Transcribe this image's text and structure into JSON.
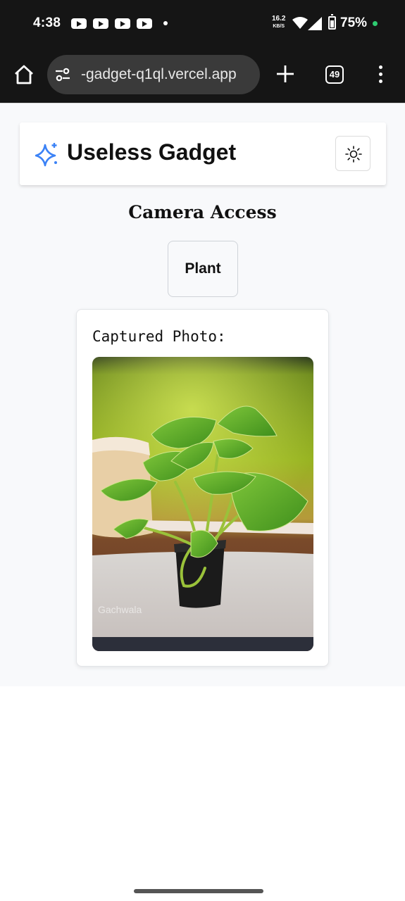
{
  "status_bar": {
    "time": "4:38",
    "net_speed": "16.2",
    "net_unit": "KB/S",
    "battery": "75%"
  },
  "browser": {
    "url": "-gadget-q1ql.vercel.app",
    "tab_count": "49"
  },
  "header": {
    "title": "Useless Gadget"
  },
  "main": {
    "section_title": "Camera Access",
    "plant_button_label": "Plant",
    "photo_label": "Captured Photo:",
    "photo_watermark": "Gachwala"
  },
  "colors": {
    "accent": "#3b82f6",
    "page_bg": "#f8f9fb",
    "status_green": "#2ecc71"
  }
}
